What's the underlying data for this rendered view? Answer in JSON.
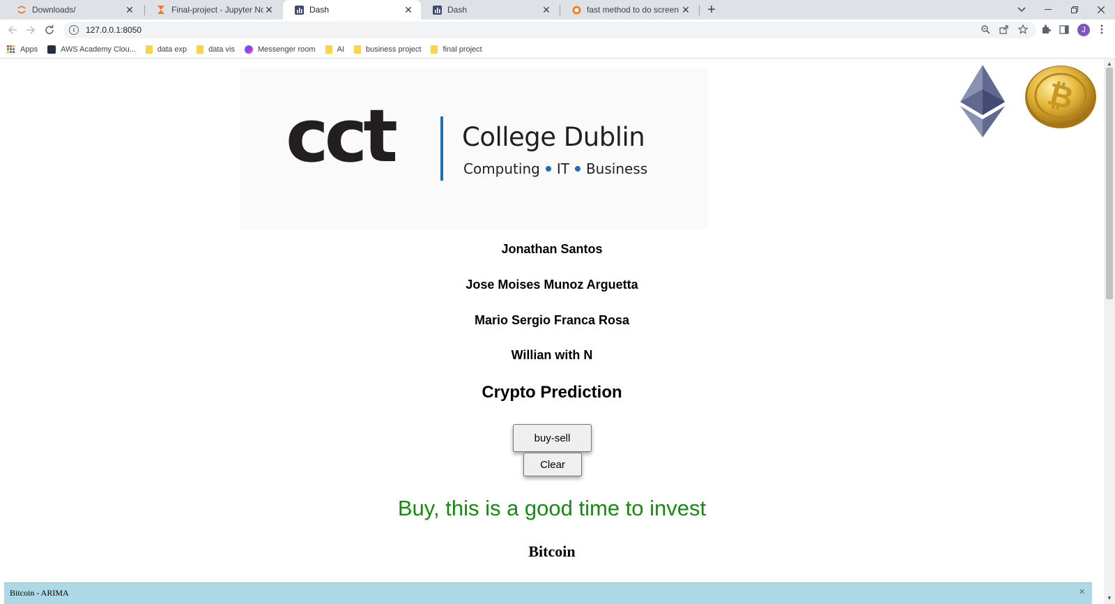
{
  "browser": {
    "tabs": [
      {
        "title": "Downloads/",
        "active": false,
        "icon": "jupyter-icon"
      },
      {
        "title": "Final-project - Jupyter Notebook",
        "active": false,
        "icon": "hourglass-icon"
      },
      {
        "title": "Dash",
        "active": true,
        "icon": "dash-chart-icon"
      },
      {
        "title": "Dash",
        "active": false,
        "icon": "dash-chart-icon"
      },
      {
        "title": "fast method to do screen shot w",
        "active": false,
        "icon": "orange-globe-icon"
      }
    ],
    "close_glyph": "✕",
    "new_tab_glyph": "+",
    "url": "127.0.0.1:8050",
    "avatar_letter": "J",
    "bookmarks": [
      {
        "label": "Apps",
        "icon": "apps-grid-icon"
      },
      {
        "label": "AWS Academy Clou...",
        "icon": "aws-icon"
      },
      {
        "label": "data exp",
        "icon": "folder-icon"
      },
      {
        "label": "data vis",
        "icon": "folder-icon"
      },
      {
        "label": "Messenger room",
        "icon": "messenger-icon"
      },
      {
        "label": "AI",
        "icon": "folder-icon"
      },
      {
        "label": "business project",
        "icon": "folder-icon"
      },
      {
        "label": "final project",
        "icon": "folder-icon"
      }
    ]
  },
  "page": {
    "logo": {
      "mark": "cct",
      "name": "College Dublin",
      "sub": [
        "Computing",
        "IT",
        "Business"
      ]
    },
    "members": [
      "Jonathan Santos",
      "Jose Moises Munoz Arguetta",
      "Mario Sergio Franca Rosa",
      "Willian with N"
    ],
    "heading": "Crypto Prediction",
    "buy_sell_label": "buy-sell",
    "clear_label": "Clear",
    "result_text": "Buy, this is a good time to invest",
    "coin_title": "Bitcoin",
    "panel_title": "Bitcoin - ARIMA",
    "colors": {
      "result": "#178a11",
      "panel": "#add8e6",
      "logo_accent": "#1d6fb8"
    }
  }
}
